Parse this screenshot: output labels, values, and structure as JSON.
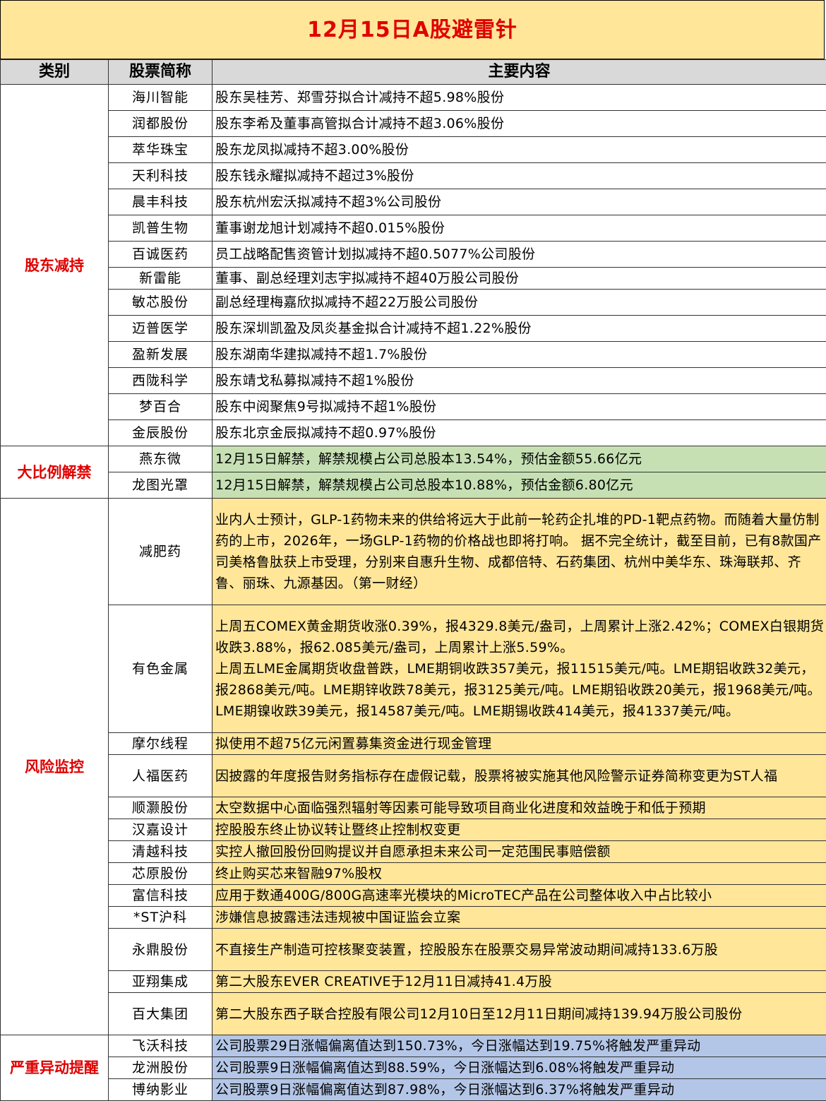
{
  "title": "12月15日A股避雷针",
  "headers": [
    "类别",
    "股票简称",
    "主要内容"
  ],
  "sections": {
    "holder_reduce": "股东减持",
    "unlock": "大比例解禁",
    "risk": "风险监控",
    "abnormal": "严重异动提醒"
  },
  "rows": [
    {
      "name": "海川智能",
      "content": "股东吴桂芳、郑雪芬拟合计减持不超5.98%股份"
    },
    {
      "name": "润都股份",
      "content": "股东李希及董事高管拟合计减持不超3.06%股份"
    },
    {
      "name": "萃华珠宝",
      "content": "股东龙凤拟减持不超3.00%股份"
    },
    {
      "name": "天利科技",
      "content": "股东钱永耀拟减持不超过3%股份"
    },
    {
      "name": "晨丰科技",
      "content": "股东杭州宏沃拟减持不超3%公司股份"
    },
    {
      "name": "凯普生物",
      "content": "董事谢龙旭计划减持不超0.015%股份"
    },
    {
      "name": "百诚医药",
      "content": "员工战略配售资管计划拟减持不超0.5077%公司股份"
    },
    {
      "name": "新雷能",
      "content": "董事、副总经理刘志宇拟减持不超40万股公司股份"
    },
    {
      "name": "敏芯股份",
      "content": "副总经理梅嘉欣拟减持不超22万股公司股份"
    },
    {
      "name": "迈普医学",
      "content": "股东深圳凯盈及凤炎基金拟合计减持不超1.22%股份"
    },
    {
      "name": "盈新发展",
      "content": "股东湖南华建拟减持不超1.7%股份"
    },
    {
      "name": "西陇科学",
      "content": "股东靖戈私募拟减持不超1%股份"
    },
    {
      "name": "梦百合",
      "content": "股东中阅聚焦9号拟减持不超1%股份"
    },
    {
      "name": "金辰股份",
      "content": "股东北京金辰拟减持不超0.97%股份"
    },
    {
      "name": "燕东微",
      "content": "12月15日解禁，解禁规模占公司总股本13.54%，预估金额55.66亿元"
    },
    {
      "name": "龙图光罩",
      "content": "12月15日解禁，解禁规模占公司总股本10.88%，预估金额6.80亿元"
    },
    {
      "name": "减肥药",
      "content": "业内人士预计，GLP-1药物未来的供给将远大于此前一轮药企扎堆的PD-1靶点药物。而随着大量仿制药的上市，2026年，一场GLP-1药物的价格战也即将打响。 据不完全统计，截至目前，已有8款国产司美格鲁肽获上市受理，分别来自惠升生物、成都倍特、石药集团、杭州中美华东、珠海联邦、齐鲁、丽珠、九源基因。（第一财经）"
    },
    {
      "name": "有色金属",
      "content": "上周五COMEX黄金期货收涨0.39%，报4329.8美元/盎司，上周累计上涨2.42%；COMEX白银期货收跌3.88%，报62.085美元/盎司，上周累计上涨5.59%。",
      "content2": "上周五LME金属期货收盘普跌，LME期铜收跌357美元，报11515美元/吨。LME期铝收跌32美元，报2868美元/吨。LME期锌收跌78美元，报3125美元/吨。LME期铅收跌20美元，报1968美元/吨。LME期镍收跌39美元，报14587美元/吨。LME期锡收跌414美元，报41337美元/吨。"
    },
    {
      "name": "摩尔线程",
      "content": "拟使用不超75亿元闲置募集资金进行现金管理"
    },
    {
      "name": "人福医药",
      "content": "因披露的年度报告财务指标存在虚假记载，股票将被实施其他风险警示证券简称变更为ST人福"
    },
    {
      "name": "顺灏股份",
      "content": "太空数据中心面临强烈辐射等因素可能导致项目商业化进度和效益晚于和低于预期"
    },
    {
      "name": "汉嘉设计",
      "content": "控股股东终止协议转让暨终止控制权变更"
    },
    {
      "name": "清越科技",
      "content": "实控人撤回股份回购提议并自愿承担未来公司一定范围民事赔偿额"
    },
    {
      "name": "芯原股份",
      "content": "终止购买芯来智融97%股权"
    },
    {
      "name": "富信科技",
      "content": "应用于数通400G/800G高速率光模块的MicroTEC产品在公司整体收入中占比较小"
    },
    {
      "name": "*ST沪科",
      "content": "涉嫌信息披露违法违规被中国证监会立案"
    },
    {
      "name": "永鼎股份",
      "content": "不直接生产制造可控核聚变装置，控股股东在股票交易异常波动期间减持133.6万股"
    },
    {
      "name": "亚翔集成",
      "content": "第二大股东EVER CREATIVE于12月11日减持41.4万股"
    },
    {
      "name": "百大集团",
      "content": "第二大股东西子联合控股有限公司12月10日至12月11日期间减持139.94万股公司股份"
    },
    {
      "name": "飞沃科技",
      "content": "公司股票29日涨幅偏离值达到150.73%，今日涨幅达到19.75%将触发严重异动"
    },
    {
      "name": "龙洲股份",
      "content": "公司股票9日涨幅偏离值达到88.59%，今日涨幅达到6.08%将触发严重异动"
    },
    {
      "name": "博纳影业",
      "content": "公司股票9日涨幅偏离值达到87.98%，今日涨幅达到6.37%将触发严重异动"
    }
  ],
  "colors": {
    "title_bg": "#ffe699",
    "title_text": "#e00000",
    "yellow": "#ffe699",
    "green": "#c6e0b4",
    "blue": "#b4c6e7",
    "header_bg": "#d9d9d9"
  }
}
